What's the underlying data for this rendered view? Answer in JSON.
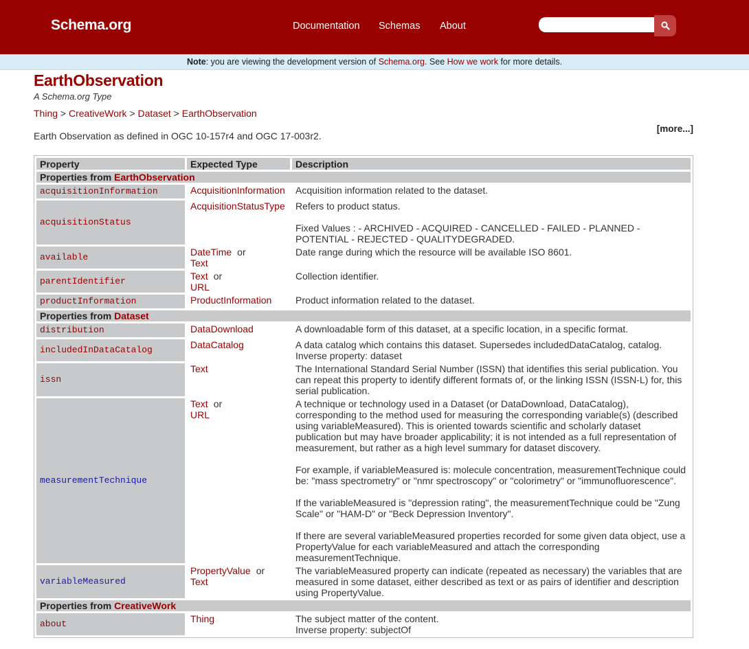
{
  "header": {
    "logo": "Schema.org",
    "nav": [
      "Documentation",
      "Schemas",
      "About"
    ],
    "search_placeholder": ""
  },
  "note": {
    "bold": "Note",
    "text1": ": you are viewing the development version of ",
    "link1": "Schema.org",
    "text2": ". See ",
    "link2": "How we work",
    "text3": " for more details."
  },
  "page": {
    "title": "EarthObservation",
    "subtitle": "A Schema.org Type",
    "breadcrumb": [
      "Thing",
      "CreativeWork",
      "Dataset",
      "EarthObservation"
    ],
    "breadcrumb_sep": ">",
    "more": "[more...]",
    "description": "Earth Observation as defined in OGC 10-157r4 and OGC 17-003r2."
  },
  "table": {
    "headers": [
      "Property",
      "Expected Type",
      "Description"
    ],
    "sections": [
      {
        "prefix": "Properties from ",
        "name": "EarthObservation",
        "rows": [
          {
            "prop": "acquisitionInformation",
            "types": [
              "AcquisitionInformation"
            ],
            "desc": [
              "Acquisition information related to the dataset."
            ]
          },
          {
            "prop": "acquisitionStatus",
            "types": [
              "AcquisitionStatusType"
            ],
            "desc": [
              "Refers to product status.",
              "",
              "Fixed Values : - ARCHIVED - ACQUIRED - CANCELLED - FAILED - PLANNED - POTENTIAL - REJECTED - QUALITYDEGRADED."
            ]
          },
          {
            "prop": "available",
            "types": [
              "DateTime",
              "Text"
            ],
            "desc": [
              "Date range during which the resource will be available ISO 8601."
            ]
          },
          {
            "prop": "parentIdentifier",
            "types": [
              "Text",
              "URL"
            ],
            "desc": [
              "Collection identifier."
            ]
          },
          {
            "prop": "productInformation",
            "types": [
              "ProductInformation"
            ],
            "desc": [
              "Product information related to the dataset."
            ]
          }
        ]
      },
      {
        "prefix": "Properties from ",
        "name": "Dataset",
        "rows": [
          {
            "prop": "distribution",
            "types": [
              "DataDownload"
            ],
            "desc": [
              "A downloadable form of this dataset, at a specific location, in a specific format."
            ]
          },
          {
            "prop": "includedInDataCatalog",
            "types": [
              "DataCatalog"
            ],
            "desc": [
              "A data catalog which contains this dataset. Supersedes includedDataCatalog, catalog.",
              "Inverse property: dataset"
            ]
          },
          {
            "prop": "issn",
            "types": [
              "Text"
            ],
            "desc": [
              "The International Standard Serial Number (ISSN) that identifies this serial publication. You can repeat this property to identify different formats of, or the linking ISSN (ISSN-L) for, this serial publication."
            ]
          },
          {
            "prop": "measurementTechnique",
            "blue": true,
            "types": [
              "Text",
              "URL"
            ],
            "desc": [
              "A technique or technology used in a Dataset (or DataDownload, DataCatalog), corresponding to the method used for measuring the corresponding variable(s) (described using variableMeasured). This is oriented towards scientific and scholarly dataset publication but may have broader applicability; it is not intended as a full representation of measurement, but rather as a high level summary for dataset discovery.",
              "",
              "For example, if variableMeasured is: molecule concentration, measurementTechnique could be: \"mass spectrometry\" or \"nmr spectroscopy\" or \"colorimetry\" or \"immunofluorescence\".",
              "",
              "If the variableMeasured is \"depression rating\", the measurementTechnique could be \"Zung Scale\" or \"HAM-D\" or \"Beck Depression Inventory\".",
              "",
              "If there are several variableMeasured properties recorded for some given data object, use a PropertyValue for each variableMeasured and attach the corresponding measurementTechnique."
            ]
          },
          {
            "prop": "variableMeasured",
            "blue": true,
            "types": [
              "PropertyValue",
              "Text"
            ],
            "desc": [
              "The variableMeasured property can indicate (repeated as necessary) the variables that are measured in some dataset, either described as text or as pairs of identifier and description using PropertyValue."
            ]
          }
        ]
      },
      {
        "prefix": "Properties from ",
        "name": "CreativeWork",
        "rows": [
          {
            "prop": "about",
            "types": [
              "Thing"
            ],
            "desc": [
              "The subject matter of the content.",
              "Inverse property: subjectOf"
            ]
          }
        ]
      }
    ],
    "or_word": "or"
  }
}
